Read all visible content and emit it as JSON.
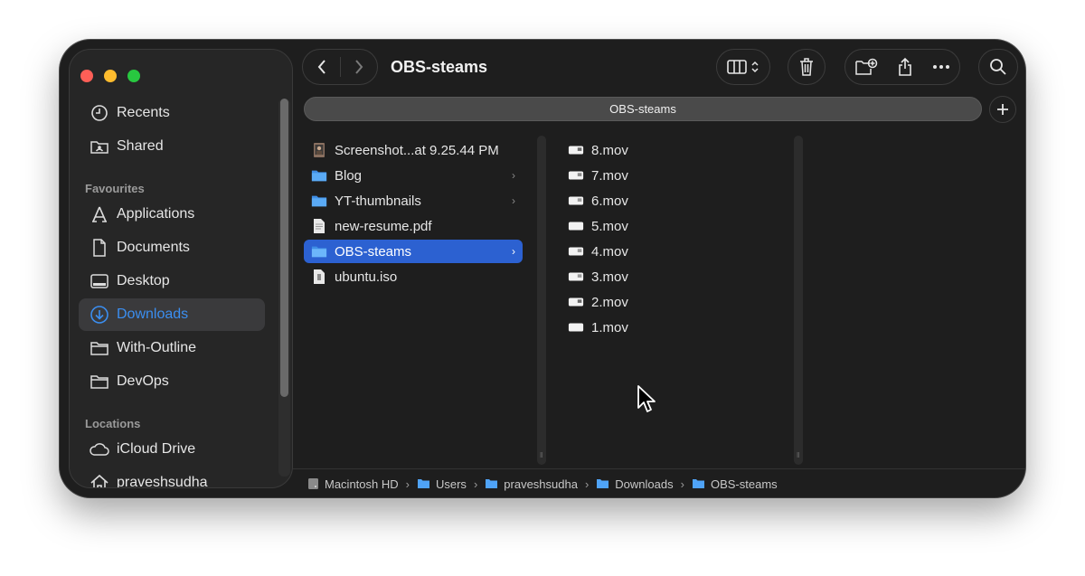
{
  "window": {
    "title": "OBS-steams",
    "tab_label": "OBS-steams"
  },
  "sidebar": {
    "items_top": [
      {
        "label": "Recents",
        "icon": "clock-icon"
      },
      {
        "label": "Shared",
        "icon": "shared-folder-icon"
      }
    ],
    "favourites_heading": "Favourites",
    "favourites": [
      {
        "label": "Applications",
        "icon": "applications-icon"
      },
      {
        "label": "Documents",
        "icon": "document-icon"
      },
      {
        "label": "Desktop",
        "icon": "desktop-icon"
      },
      {
        "label": "Downloads",
        "icon": "download-icon",
        "active": true
      },
      {
        "label": "With-Outline",
        "icon": "folder-icon"
      },
      {
        "label": "DevOps",
        "icon": "folder-icon"
      }
    ],
    "locations_heading": "Locations",
    "locations": [
      {
        "label": "iCloud Drive",
        "icon": "cloud-icon"
      },
      {
        "label": "praveshsudha",
        "icon": "home-icon"
      }
    ]
  },
  "column1": [
    {
      "name": "Screenshot...at 9.25.44 PM",
      "icon": "image-file-icon",
      "folder": false
    },
    {
      "name": "Blog",
      "icon": "folder-icon",
      "folder": true
    },
    {
      "name": "YT-thumbnails",
      "icon": "folder-icon",
      "folder": true
    },
    {
      "name": "new-resume.pdf",
      "icon": "pdf-file-icon",
      "folder": false
    },
    {
      "name": "OBS-steams",
      "icon": "folder-icon",
      "folder": true,
      "selected": true
    },
    {
      "name": "ubuntu.iso",
      "icon": "iso-file-icon",
      "folder": false
    }
  ],
  "column2": [
    "8.mov",
    "7.mov",
    "6.mov",
    "5.mov",
    "4.mov",
    "3.mov",
    "2.mov",
    "1.mov"
  ],
  "pathbar": [
    "Macintosh HD",
    "Users",
    "praveshsudha",
    "Downloads",
    "OBS-steams"
  ],
  "colors": {
    "accent": "#3b8ef0",
    "selection": "#2c61d1",
    "folder": "#4fa3f7"
  }
}
